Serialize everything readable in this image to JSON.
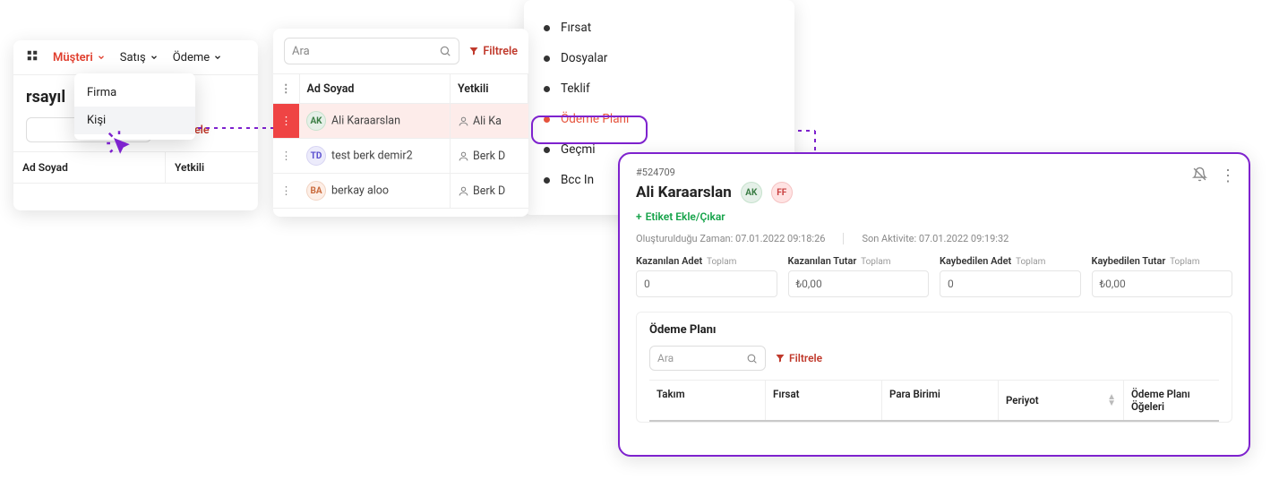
{
  "nav": {
    "musteri": "Müşteri",
    "satis": "Satış",
    "odeme": "Ödeme"
  },
  "page_title_fragment": "rsayıl",
  "filter_label": "Filtrele",
  "search_placeholder": "Ara",
  "dropdown1": {
    "firma": "Firma",
    "kisi": "Kişi"
  },
  "table1": {
    "col_ad_soyad": "Ad Soyad",
    "col_yetkili": "Yetkili"
  },
  "table2": {
    "col_ad_soyad": "Ad Soyad",
    "col_yetkili": "Yetkili",
    "rows": [
      {
        "initials": "AK",
        "name": "Ali Karaarslan",
        "yetkili": "Ali Ka"
      },
      {
        "initials": "TD",
        "name": "test berk demir2",
        "yetkili": "Berk D"
      },
      {
        "initials": "BA",
        "name": "berkay aloo",
        "yetkili": "Berk D"
      }
    ]
  },
  "tabs": {
    "firsat": "Fırsat",
    "dosyalar": "Dosyalar",
    "teklif": "Teklif",
    "odeme_plani": "Ödeme Planı",
    "gecmis": "Geçmi",
    "bcc": "Bcc In"
  },
  "detail": {
    "id": "#524709",
    "name": "Ali Karaarslan",
    "chip1": "AK",
    "chip2": "FF",
    "etiket": "Etiket Ekle/Çıkar",
    "created_label": "Oluşturulduğu Zaman:",
    "created_value": "07.01.2022 09:18:26",
    "activity_label": "Son Aktivite:",
    "activity_value": "07.01.2022 09:19:32",
    "stat_labels": {
      "kazanilan_adet": "Kazanılan Adet",
      "kazanilan_tutar": "Kazanılan Tutar",
      "kaybedilen_adet": "Kaybedilen Adet",
      "kaybedilen_tutar": "Kaybedilen Tutar",
      "toplam": "Toplam"
    },
    "stat_values": {
      "kazanilan_adet": "0",
      "kazanilan_tutar": "₺0,00",
      "kaybedilen_adet": "0",
      "kaybedilen_tutar": "₺0,00"
    },
    "section_title": "Ödeme Planı",
    "section_cols": {
      "takim": "Takım",
      "firsat": "Fırsat",
      "para_birimi": "Para Birimi",
      "periyot": "Periyot",
      "ogeler": "Ödeme Planı Öğeleri"
    }
  }
}
